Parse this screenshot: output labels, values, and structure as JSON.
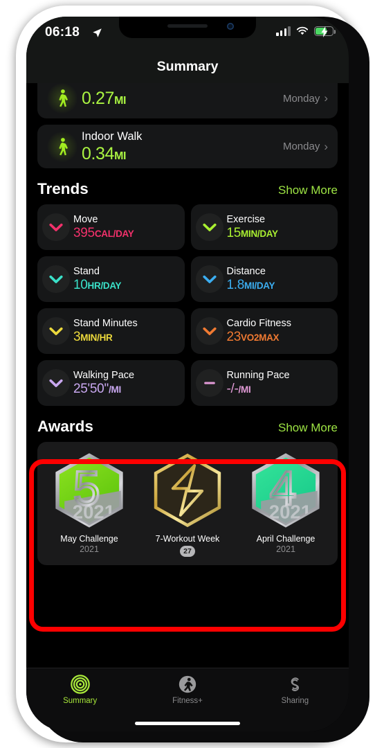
{
  "status_bar": {
    "time": "06:18",
    "location_icon": "location-arrow-icon",
    "cellular_icon": "cellular-bars-icon",
    "wifi_icon": "wifi-icon",
    "battery_icon": "battery-charging-icon"
  },
  "nav": {
    "title": "Summary"
  },
  "workouts": [
    {
      "name": "",
      "value": "0.27",
      "unit": "MI",
      "day": "Monday",
      "icon": "walking-person-icon",
      "clipped": true
    },
    {
      "name": "Indoor Walk",
      "value": "0.34",
      "unit": "MI",
      "day": "Monday",
      "icon": "walking-person-icon",
      "clipped": false
    }
  ],
  "trends": {
    "title": "Trends",
    "show_more": "Show More",
    "items": [
      {
        "name": "Move",
        "value": "395",
        "unit": "CAL/DAY",
        "color": "#f2316b",
        "arrow": "chevron-down-icon"
      },
      {
        "name": "Exercise",
        "value": "15",
        "unit": "MIN/DAY",
        "color": "#a9ef31",
        "arrow": "chevron-down-icon"
      },
      {
        "name": "Stand",
        "value": "10",
        "unit": "HR/DAY",
        "color": "#3ae0c8",
        "arrow": "chevron-down-icon"
      },
      {
        "name": "Distance",
        "value": "1.8",
        "unit": "MI/DAY",
        "color": "#3badf0",
        "arrow": "chevron-down-icon"
      },
      {
        "name": "Stand Minutes",
        "value": "3",
        "unit": "MIN/HR",
        "color": "#ecd93c",
        "arrow": "chevron-down-icon"
      },
      {
        "name": "Cardio Fitness",
        "value": "23",
        "unit": "VO2MAX",
        "color": "#f07a32",
        "arrow": "chevron-down-icon"
      },
      {
        "name": "Walking Pace",
        "value": "25'50''",
        "unit": "/MI",
        "color": "#c9a8f0",
        "arrow": "chevron-down-icon"
      },
      {
        "name": "Running Pace",
        "value": "-/-",
        "unit": "/MI",
        "color": "#e19ad6",
        "arrow": "minus-dash-icon"
      }
    ]
  },
  "awards": {
    "title": "Awards",
    "show_more": "Show More",
    "items": [
      {
        "label": "May Challenge",
        "sub": "2021",
        "count": "",
        "badge": "hexagon-5-green-icon"
      },
      {
        "label": "7-Workout Week",
        "sub": "",
        "count": "27",
        "badge": "hexagon-bolt-gold-icon"
      },
      {
        "label": "April Challenge",
        "sub": "2021",
        "count": "",
        "badge": "hexagon-4-teal-icon"
      }
    ]
  },
  "tabbar": {
    "items": [
      {
        "label": "Summary",
        "icon": "activity-rings-icon",
        "active": true
      },
      {
        "label": "Fitness+",
        "icon": "running-person-icon",
        "active": false
      },
      {
        "label": "Sharing",
        "icon": "sharing-s-icon",
        "active": false
      }
    ]
  },
  "annotation": {
    "highlight_color": "#fe0000"
  }
}
